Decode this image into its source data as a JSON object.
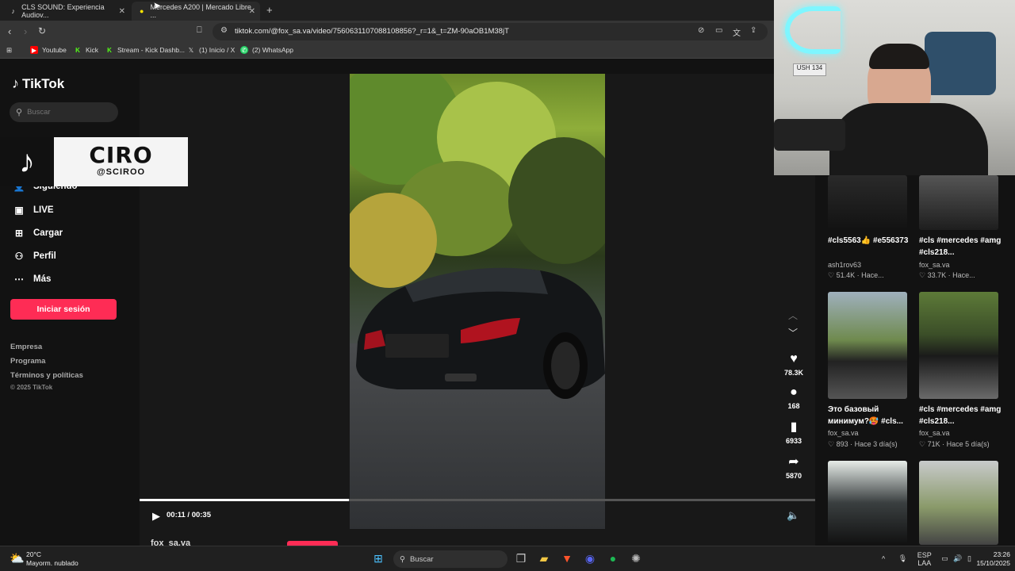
{
  "browser": {
    "tabs": [
      {
        "title": "CLS SOUND: Experiencia Audiov...",
        "active": false
      },
      {
        "title": "Mercedes A200 | Mercado Libre ...",
        "active": true
      }
    ],
    "url": "tiktok.com/@fox_sa.va/video/7560631107088108856?_r=1&_t=ZM-90aOB1M38jT",
    "bookmarks": [
      "Youtube",
      "Kick",
      "Stream - Kick Dashb...",
      "(1) Inicio / X",
      "(2) WhatsApp"
    ]
  },
  "tiktok": {
    "logo": "TikTok",
    "search_placeholder": "Buscar",
    "nav": {
      "following": "Siguiendo",
      "live": "LIVE",
      "upload": "Cargar",
      "profile": "Perfil",
      "more": "Más"
    },
    "login": "Iniciar sesión",
    "footer": {
      "company": "Empresa",
      "program": "Programa",
      "terms": "Términos y políticas",
      "copyright": "© 2025 TikTok"
    },
    "overlay": {
      "name": "CIRO",
      "handle": "@SCIROO"
    },
    "player": {
      "time": "00:11 / 00:35",
      "progress": 0.31,
      "likes": "78.3K",
      "comments": "168",
      "saves": "6933",
      "shares": "5870",
      "author": "fox_sa.va"
    },
    "related": [
      {
        "caption": "#cls5563👍 #e556373",
        "author": "ash1rov63",
        "stats": "♡ 51.4K · Hace..."
      },
      {
        "caption": "#cls #mercedes #amg #cls218...",
        "author": "fox_sa.va",
        "stats": "♡ 33.7K · Hace..."
      },
      {
        "caption": "Это базовый минимум?🥵 #cls...",
        "author": "fox_sa.va",
        "stats": "♡ 893 · Hace 3 día(s)"
      },
      {
        "caption": "#cls #mercedes #amg #cls218...",
        "author": "fox_sa.va",
        "stats": "♡ 71K · Hace 5 día(s)"
      }
    ]
  },
  "taskbar": {
    "weather_temp": "20°C",
    "weather_desc": "Mayorm. nublado",
    "search": "Buscar",
    "lang_top": "ESP",
    "lang_bottom": "LAA",
    "time": "23:26",
    "date": "15/10/2025"
  },
  "colors": {
    "accent": "#fe2c55",
    "background": "#121212"
  }
}
